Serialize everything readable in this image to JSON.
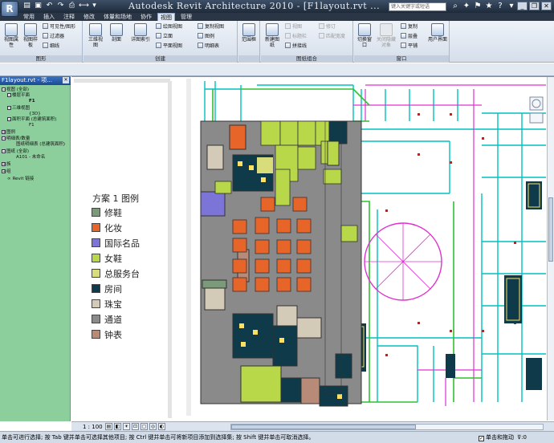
{
  "app": {
    "logo_letter": "R",
    "title": "Autodesk Revit Architecture 2010 - [F1layout.rvt ...",
    "search_placeholder": "键入关键字或短语",
    "quick_access": [
      "open-icon",
      "save-icon",
      "undo-icon",
      "redo-icon",
      "print-icon",
      "measure-icon",
      "settings-icon"
    ],
    "window_buttons": {
      "minimize": "_",
      "restore": "❐",
      "close": "✕"
    }
  },
  "menu_tabs": [
    "常用",
    "插入",
    "注释",
    "修改",
    "体量和场地",
    "协作",
    "视图",
    "管理"
  ],
  "active_tab": "视图",
  "ribbon": {
    "panels": [
      {
        "label": "图形",
        "big": [
          "视图属性",
          "视图样板"
        ],
        "small": [
          "可见性/图形",
          "过滤器",
          "细线"
        ]
      },
      {
        "label": "创建",
        "big": [
          "三维视图",
          "剖面",
          "详图索引"
        ],
        "small": [
          "绘图视图",
          "立面",
          "平面视图",
          "复制视图",
          "图例",
          "明细表"
        ]
      },
      {
        "label": "",
        "big": [
          "范围框"
        ],
        "small": []
      },
      {
        "label": "图纸组合",
        "big": [
          "新建图纸"
        ],
        "small": [
          "视图",
          "标题栏",
          "拼接线",
          "修订",
          "匹配宽度"
        ]
      },
      {
        "label": "窗口",
        "big": [
          "切换窗口",
          "关闭隐藏对象",
          "用户界面"
        ],
        "small": [
          "复制",
          "层叠",
          "平铺"
        ]
      }
    ]
  },
  "browser": {
    "title": "F1layout.rvt - 项...",
    "items": [
      "视图 (全部)",
      "楼层平面",
      "F1",
      "三维视图",
      "{3D}",
      "面积平面 (总建筑面积)",
      "F1",
      "图例",
      "明细表/数量",
      "图纸明细表 (总建筑面积)",
      "图纸 (全部)",
      "A101 - 未命名",
      "族",
      "组",
      "Revit 链接"
    ]
  },
  "legend": {
    "title": "方案 1 图例",
    "entries": [
      {
        "label": "修鞋",
        "color": "#7a9a7a"
      },
      {
        "label": "化妆",
        "color": "#e8652a"
      },
      {
        "label": "国际名品",
        "color": "#7d74d8"
      },
      {
        "label": "女鞋",
        "color": "#b8d84a"
      },
      {
        "label": "总服务台",
        "color": "#d8dc7a"
      },
      {
        "label": "房间",
        "color": "#0e3a4a"
      },
      {
        "label": "珠宝",
        "color": "#d4cab8"
      },
      {
        "label": "通道",
        "color": "#8a8a8a"
      },
      {
        "label": "钟表",
        "color": "#b88a78"
      }
    ]
  },
  "view_control": {
    "scale": "1 : 100"
  },
  "status": {
    "text": "单击可进行选择; 按 Tab 键并单击可选择其他项目; 按 Ctrl 键并单击可将新项目添加到选择集; 按 Shift 键并单击可取消选择。",
    "checkbox_label": "单击和拖动",
    "filter_count": ":0"
  }
}
